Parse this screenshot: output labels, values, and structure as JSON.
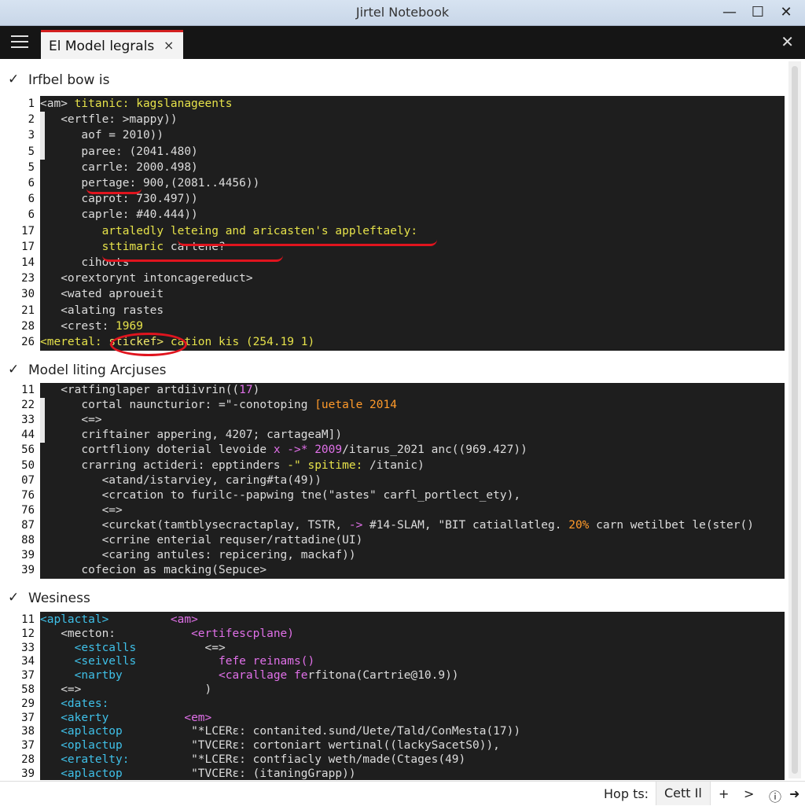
{
  "window": {
    "title": "Jirtel Notebook",
    "minimize": "—",
    "maximize": "☐",
    "close": "✕"
  },
  "tabbar": {
    "tab_label": "El Model legrals",
    "tab_close": "×",
    "pane_close": "✕"
  },
  "sections": [
    {
      "title": "Irfbel bow is",
      "lines": [
        {
          "n": "1",
          "segs": [
            [
              "g",
              "<am> "
            ],
            [
              "y",
              "titanic: kagslanageents"
            ]
          ]
        },
        {
          "n": "2",
          "segs": [
            [
              "g",
              "   <ertfle: >mappy))"
            ]
          ]
        },
        {
          "n": "3",
          "segs": [
            [
              "g",
              "      aof = 2010))"
            ]
          ]
        },
        {
          "n": "5",
          "segs": [
            [
              "g",
              "      paree: (2041.480)"
            ]
          ]
        },
        {
          "n": "5",
          "segs": [
            [
              "g",
              "      carrle: 2000.498)"
            ]
          ]
        },
        {
          "n": "6",
          "segs": [
            [
              "g",
              "      pertage: 900,(2081..4456))"
            ]
          ]
        },
        {
          "n": "6",
          "segs": [
            [
              "g",
              "      caprot: 730.497))"
            ]
          ]
        },
        {
          "n": "6",
          "segs": [
            [
              "g",
              "      caprle: #40.444))"
            ]
          ]
        },
        {
          "n": "17",
          "segs": [
            [
              "y",
              "         artaledly leteing and aricasten's appleftaely:"
            ]
          ]
        },
        {
          "n": "17",
          "segs": [
            [
              "y",
              "         sttimaric "
            ],
            [
              "g",
              "cartene?"
            ]
          ]
        },
        {
          "n": "14",
          "segs": [
            [
              "g",
              "      cihoots"
            ]
          ]
        },
        {
          "n": "23",
          "segs": [
            [
              "g",
              "   <orextorynt intoncagereduct>"
            ]
          ]
        },
        {
          "n": "30",
          "segs": [
            [
              "g",
              "   <wated aproueit"
            ]
          ]
        },
        {
          "n": "21",
          "segs": [
            [
              "g",
              "   <alating rastes"
            ]
          ]
        },
        {
          "n": "28",
          "segs": [
            [
              "g",
              "   <crest: "
            ],
            [
              "y",
              "1969"
            ]
          ]
        },
        {
          "n": "26",
          "segs": [
            [
              "y",
              "<meretal: "
            ],
            [
              "yb",
              "stickef> "
            ],
            [
              "y",
              "cation kis (254.19 1)"
            ]
          ]
        }
      ]
    },
    {
      "title": "Model liting Arcjuses",
      "lines": [
        {
          "n": "11",
          "segs": [
            [
              "g",
              "   <ratfinglaper artdiivrin(("
            ],
            [
              "m",
              "17"
            ],
            [
              "g",
              ")"
            ]
          ]
        },
        {
          "n": "22",
          "segs": [
            [
              "g",
              "      cortal nauncturior: =\"-conotoping "
            ],
            [
              "o",
              "[uetale 2014"
            ]
          ]
        },
        {
          "n": "33",
          "segs": [
            [
              "g",
              "      <=>"
            ]
          ]
        },
        {
          "n": "44",
          "segs": [
            [
              "g",
              "      criftainer appering, 4207; cartageaM])"
            ]
          ]
        },
        {
          "n": "56",
          "segs": [
            [
              "g",
              "      cortfliony doterial levoide "
            ],
            [
              "m",
              "x ->* 2009"
            ],
            [
              "g",
              "/itarus_2021 anc((969.427))"
            ]
          ]
        },
        {
          "n": "50",
          "segs": [
            [
              "g",
              "      crarring actideri: epptinders "
            ],
            [
              "y",
              "-\" spitime: "
            ],
            [
              "g",
              "/itanic)"
            ]
          ]
        },
        {
          "n": "07",
          "segs": [
            [
              "g",
              "         <atand/istarviey, caring#ta(49))"
            ]
          ]
        },
        {
          "n": "76",
          "segs": [
            [
              "g",
              "         <crcation to furilc--papwing tne(\"astes\" carfl_portlect_ety),"
            ]
          ]
        },
        {
          "n": "76",
          "segs": [
            [
              "g",
              "         <=>"
            ]
          ]
        },
        {
          "n": "87",
          "segs": [
            [
              "g",
              "         <curckat(tamtblysecractaplay, TSTR, "
            ],
            [
              "m",
              "->"
            ],
            [
              "g",
              " #14-SLAM, \"BIT catiallatleg. "
            ],
            [
              "o",
              "20%"
            ],
            [
              "g",
              " carn wetilbet le(ster()"
            ]
          ]
        },
        {
          "n": "88",
          "segs": [
            [
              "g",
              "         <crrine enterial requser/rattadine(UI)"
            ]
          ]
        },
        {
          "n": "39",
          "segs": [
            [
              "g",
              "         <caring antules: repicering, mackaf))"
            ]
          ]
        },
        {
          "n": "39",
          "segs": [
            [
              "g",
              "      cofecion as macking(Sepuce>"
            ]
          ]
        }
      ]
    },
    {
      "title": "Wesiness",
      "lines": [
        {
          "n": "11",
          "segs": [
            [
              "c",
              "<aplactal>"
            ],
            [
              "g",
              "         "
            ],
            [
              "m",
              "<am>"
            ]
          ]
        },
        {
          "n": "12",
          "segs": [
            [
              "g",
              "   <mecton:           "
            ],
            [
              "m",
              "<ertifescplane)"
            ]
          ]
        },
        {
          "n": "33",
          "segs": [
            [
              "c",
              "     <estcalls"
            ],
            [
              "g",
              "          <=>"
            ]
          ]
        },
        {
          "n": "34",
          "segs": [
            [
              "c",
              "     <seivells"
            ],
            [
              "g",
              "            "
            ],
            [
              "m",
              "fefe reinams()"
            ]
          ]
        },
        {
          "n": "37",
          "segs": [
            [
              "c",
              "     <nartby"
            ],
            [
              "g",
              "              "
            ],
            [
              "m",
              "<carallage fe"
            ],
            [
              "g",
              "rfitona(Cartrie@10.9))"
            ]
          ]
        },
        {
          "n": "58",
          "segs": [
            [
              "g",
              "   <=>                  )"
            ]
          ]
        },
        {
          "n": "29",
          "segs": [
            [
              "c",
              "   <dates:"
            ]
          ]
        },
        {
          "n": "37",
          "segs": [
            [
              "c",
              "   <akerty"
            ],
            [
              "g",
              "           "
            ],
            [
              "m",
              "<em>"
            ]
          ]
        },
        {
          "n": "38",
          "segs": [
            [
              "c",
              "   <aplactop"
            ],
            [
              "g",
              "          \"*LCERε: contanited.sund/Uete/Tald/ConMesta(17))"
            ]
          ]
        },
        {
          "n": "37",
          "segs": [
            [
              "c",
              "   <oplactup"
            ],
            [
              "g",
              "          \"TVCERε: cortoniart wertinal((lackySacetS0)),"
            ]
          ]
        },
        {
          "n": "28",
          "segs": [
            [
              "c",
              "   <eratelty:"
            ],
            [
              "g",
              "         \"*LCERε: contfiacly weth/made(Ctages(49)"
            ]
          ]
        },
        {
          "n": "39",
          "segs": [
            [
              "c",
              "   <aplactop"
            ],
            [
              "g",
              "          \"TVCERε: (itaningGrapp))"
            ]
          ]
        }
      ]
    }
  ],
  "statusbar": {
    "hint": "Hop ts:",
    "mode": "Cett Il",
    "plus": "+",
    "next": ">",
    "info": "ⓘ",
    "arrow": "➜"
  },
  "colors": {
    "accent_red": "#d32020",
    "editor_bg": "#1e1e1e",
    "keyword_yellow": "#e6e24a",
    "magenta": "#e070e8",
    "orange": "#ff9a2a",
    "cyan": "#3fc0e8"
  }
}
